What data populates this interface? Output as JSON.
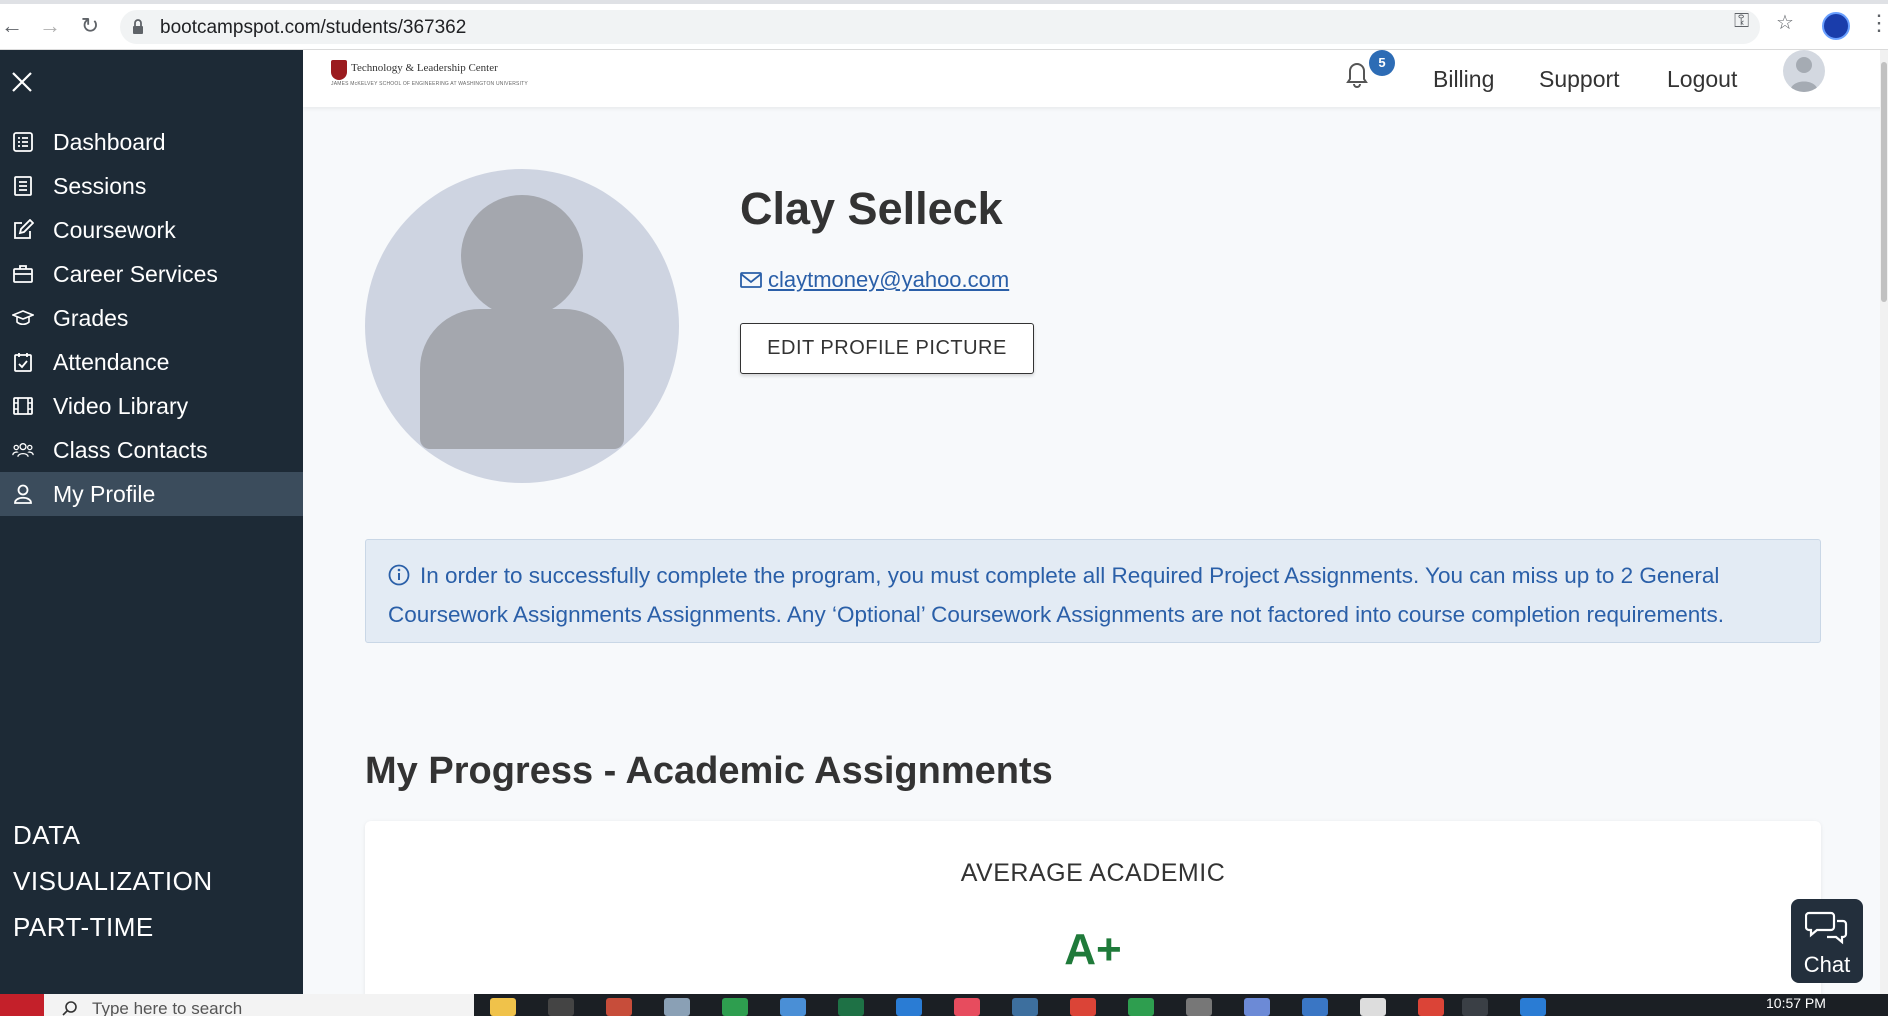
{
  "browser": {
    "url": "bootcampspot.com/students/367362"
  },
  "sidebar": {
    "items": [
      {
        "label": "Dashboard",
        "icon": "list-icon"
      },
      {
        "label": "Sessions",
        "icon": "document-icon"
      },
      {
        "label": "Coursework",
        "icon": "edit-icon"
      },
      {
        "label": "Career Services",
        "icon": "briefcase-icon"
      },
      {
        "label": "Grades",
        "icon": "graduation-cap-icon"
      },
      {
        "label": "Attendance",
        "icon": "calendar-check-icon"
      },
      {
        "label": "Video Library",
        "icon": "film-icon"
      },
      {
        "label": "Class Contacts",
        "icon": "users-icon"
      },
      {
        "label": "My Profile",
        "icon": "user-icon",
        "active": true
      }
    ],
    "program_lines": [
      "DATA",
      "VISUALIZATION",
      "PART-TIME"
    ]
  },
  "header": {
    "logo_title": "Technology & Leadership Center",
    "logo_subtitle": "JAMES McKELVEY SCHOOL OF ENGINEERING AT WASHINGTON UNIVERSITY",
    "notification_count": "5",
    "links": [
      "Billing",
      "Support",
      "Logout"
    ]
  },
  "profile": {
    "name": "Clay Selleck",
    "email": "claytmoney@yahoo.com",
    "edit_picture_label": "EDIT PROFILE PICTURE"
  },
  "alert": {
    "text": "In order to successfully complete the program, you must complete all Required Project Assignments. You can miss up to 2 General Coursework Assignments Assignments. Any ‘Optional’ Coursework Assignments are not factored into course completion requirements."
  },
  "progress": {
    "title": "My Progress - Academic Assignments",
    "card_label": "AVERAGE ACADEMIC",
    "grade": "A+"
  },
  "chat": {
    "label": "Chat"
  },
  "taskbar": {
    "search_placeholder": "Type here to search",
    "time": "10:57 PM"
  },
  "colors": {
    "sidebar_bg": "#1d2a36",
    "sidebar_active": "#3b4c5c",
    "link_blue": "#2a5fa8",
    "grade_green": "#1f7a3a",
    "badge_blue": "#2d6cb5"
  }
}
